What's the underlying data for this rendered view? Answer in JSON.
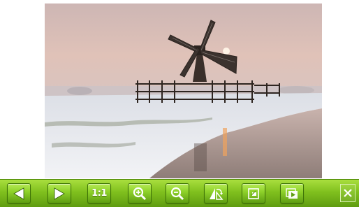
{
  "viewer": {
    "image_name": "windmill-snow-landscape-photo"
  },
  "toolbar": {
    "buttons": [
      {
        "name": "previous",
        "icon": "arrow-left-icon"
      },
      {
        "name": "next",
        "icon": "arrow-right-icon"
      },
      {
        "name": "actual-size",
        "label": "1:1"
      },
      {
        "name": "zoom-in",
        "icon": "zoom-in-icon"
      },
      {
        "name": "zoom-out",
        "icon": "zoom-out-icon"
      },
      {
        "name": "rotate",
        "icon": "rotate-icon"
      },
      {
        "name": "fit-to-screen",
        "icon": "fit-screen-icon"
      },
      {
        "name": "slideshow",
        "icon": "slideshow-icon"
      }
    ],
    "close_icon": "close-icon"
  },
  "colors": {
    "toolbar_green": "#80c01e",
    "button_green": "#8fd22b",
    "button_border": "#3f7507"
  }
}
